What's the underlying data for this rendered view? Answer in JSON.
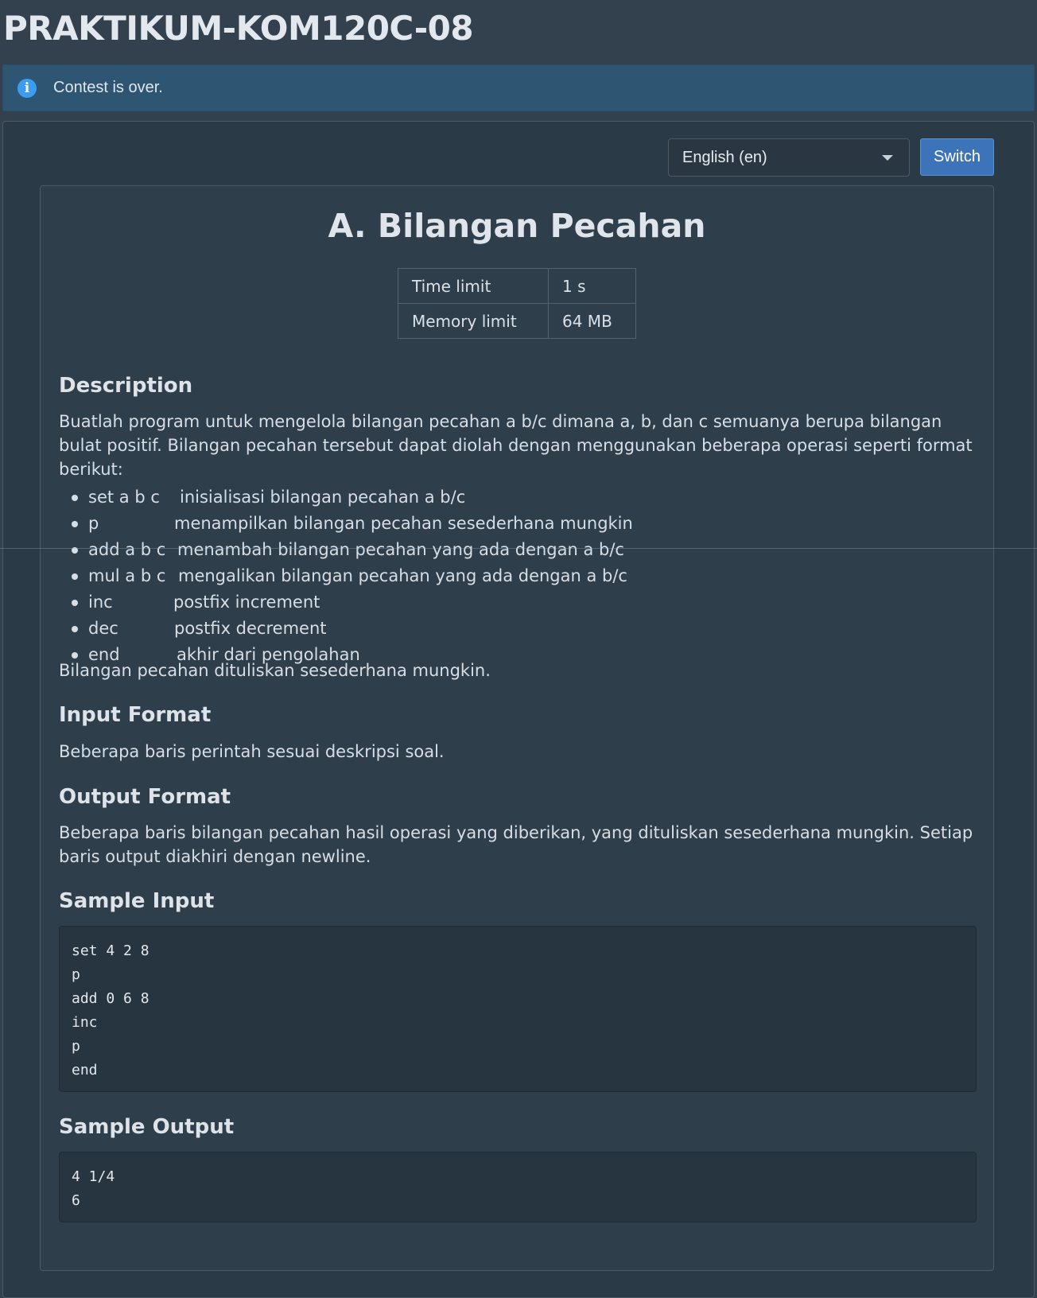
{
  "page": {
    "title": "PRAKTIKUM-KOM120C-08"
  },
  "alert": {
    "icon": "info-icon",
    "text": "Contest is over."
  },
  "language": {
    "selected": "English (en)",
    "switch_label": "Switch"
  },
  "problem": {
    "title": "A. Bilangan Pecahan",
    "limits": [
      {
        "label": "Time limit",
        "value": "1 s"
      },
      {
        "label": "Memory limit",
        "value": "64 MB"
      }
    ],
    "description": {
      "heading": "Description",
      "intro": "Buatlah program untuk mengelola bilangan pecahan a b/c dimana a, b, dan c semuanya berupa bilangan bulat positif. Bilangan pecahan tersebut dapat diolah dengan menggunakan beberapa operasi seperti format berikut:",
      "operations": [
        {
          "command": "set a b c",
          "description": "inisialisasi bilangan pecahan a b/c"
        },
        {
          "command": "p",
          "description": "menampilkan bilangan pecahan sesederhana mungkin"
        },
        {
          "command": "add a b c",
          "description": "menambah bilangan pecahan yang ada dengan a b/c"
        },
        {
          "command": "mul a b c",
          "description": "mengalikan bilangan pecahan yang ada dengan a b/c"
        },
        {
          "command": "inc",
          "description": "postfix increment"
        },
        {
          "command": "dec",
          "description": "postfix decrement"
        },
        {
          "command": "end",
          "description": "akhir dari pengolahan"
        }
      ],
      "closing": "Bilangan pecahan dituliskan sesederhana mungkin."
    },
    "input_format": {
      "heading": "Input Format",
      "text": "Beberapa baris perintah sesuai deskripsi soal."
    },
    "output_format": {
      "heading": "Output Format",
      "text": "Beberapa baris bilangan pecahan hasil operasi yang diberikan, yang dituliskan sesederhana mungkin. Setiap baris output diakhiri dengan newline."
    },
    "sample_input": {
      "heading": "Sample Input",
      "code": "set 4 2 8\np\nadd 0 6 8\ninc\np\nend"
    },
    "sample_output": {
      "heading": "Sample Output",
      "code": "4 1/4\n6"
    }
  }
}
